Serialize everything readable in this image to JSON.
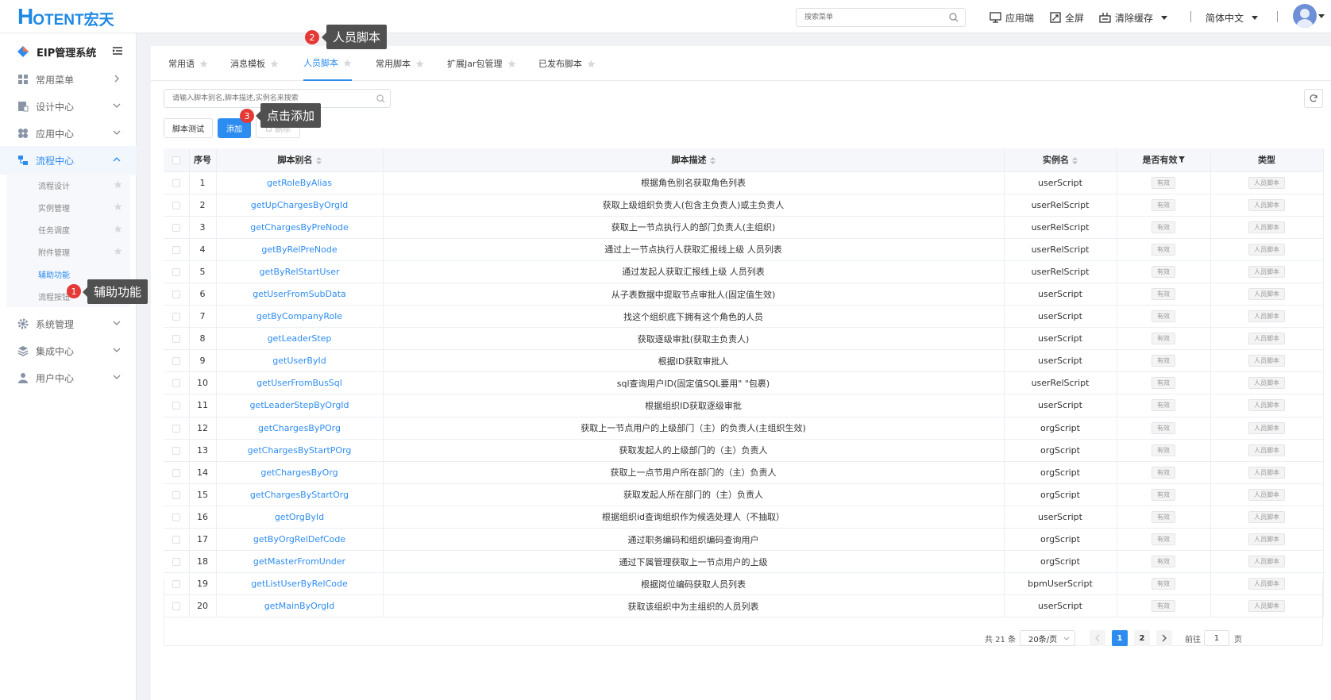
{
  "header": {
    "logo_h": "H",
    "logo_rest": "OTENT宏天",
    "search_placeholder": "搜索菜单",
    "app_end": "应用端",
    "fullscreen": "全屏",
    "clear_cache": "清除缓存",
    "language": "简体中文"
  },
  "sidebar": {
    "system_title": "EIP管理系统",
    "menus": [
      {
        "label": "常用菜单"
      },
      {
        "label": "设计中心"
      },
      {
        "label": "应用中心"
      },
      {
        "label": "流程中心"
      },
      {
        "label": "系统管理"
      },
      {
        "label": "集成中心"
      },
      {
        "label": "用户中心"
      }
    ],
    "sub_items": [
      "流程设计",
      "实例管理",
      "任务调度",
      "附件管理",
      "辅助功能",
      "流程按钮"
    ]
  },
  "tabs": [
    "常用语",
    "消息模板",
    "人员脚本",
    "常用脚本",
    "扩展Jar包管理",
    "已发布脚本"
  ],
  "toolbar": {
    "filter_placeholder": "请输入脚本别名,脚本描述,实例名来搜索",
    "test_label": "脚本测试",
    "add_label": "添加",
    "delete_label": "删除"
  },
  "table": {
    "headers": {
      "index": "序号",
      "alias": "脚本别名",
      "desc": "脚本描述",
      "instance": "实例名",
      "valid": "是否有效",
      "type": "类型"
    },
    "rows": [
      {
        "no": "1",
        "alias": "getRoleByAlias",
        "desc": "根据角色别名获取角色列表",
        "instance": "userScript",
        "valid": "有效",
        "type": "人员脚本"
      },
      {
        "no": "2",
        "alias": "getUpChargesByOrgId",
        "desc": "获取上级组织负责人(包含主负责人)或主负责人",
        "instance": "userRelScript",
        "valid": "有效",
        "type": "人员脚本"
      },
      {
        "no": "3",
        "alias": "getChargesByPreNode",
        "desc": "获取上一节点执行人的部门负责人(主组织)",
        "instance": "userRelScript",
        "valid": "有效",
        "type": "人员脚本"
      },
      {
        "no": "4",
        "alias": "getByRelPreNode",
        "desc": "通过上一节点执行人获取汇报线上级 人员列表",
        "instance": "userRelScript",
        "valid": "有效",
        "type": "人员脚本"
      },
      {
        "no": "5",
        "alias": "getByRelStartUser",
        "desc": "通过发起人获取汇报线上级 人员列表",
        "instance": "userRelScript",
        "valid": "有效",
        "type": "人员脚本"
      },
      {
        "no": "6",
        "alias": "getUserFromSubData",
        "desc": "从子表数据中提取节点审批人(固定值生效)",
        "instance": "userScript",
        "valid": "有效",
        "type": "人员脚本"
      },
      {
        "no": "7",
        "alias": "getByCompanyRole",
        "desc": "找这个组织底下拥有这个角色的人员",
        "instance": "userScript",
        "valid": "有效",
        "type": "人员脚本"
      },
      {
        "no": "8",
        "alias": "getLeaderStep",
        "desc": "获取逐级审批(获取主负责人)",
        "instance": "userScript",
        "valid": "有效",
        "type": "人员脚本"
      },
      {
        "no": "9",
        "alias": "getUserById",
        "desc": "根据ID获取审批人",
        "instance": "userScript",
        "valid": "有效",
        "type": "人员脚本"
      },
      {
        "no": "10",
        "alias": "getUserFromBusSql",
        "desc": "sql查询用户ID(固定值SQL要用\" \"包裹)",
        "instance": "userRelScript",
        "valid": "有效",
        "type": "人员脚本"
      },
      {
        "no": "11",
        "alias": "getLeaderStepByOrgId",
        "desc": "根据组织ID获取逐级审批",
        "instance": "userScript",
        "valid": "有效",
        "type": "人员脚本"
      },
      {
        "no": "12",
        "alias": "getChargesByPOrg",
        "desc": "获取上一节点用户的上级部门（主）的负责人(主组织生效)",
        "instance": "orgScript",
        "valid": "有效",
        "type": "人员脚本"
      },
      {
        "no": "13",
        "alias": "getChargesByStartPOrg",
        "desc": "获取发起人的上级部门的（主）负责人",
        "instance": "orgScript",
        "valid": "有效",
        "type": "人员脚本"
      },
      {
        "no": "14",
        "alias": "getChargesByOrg",
        "desc": "获取上一点节用户所在部门的（主）负责人",
        "instance": "orgScript",
        "valid": "有效",
        "type": "人员脚本"
      },
      {
        "no": "15",
        "alias": "getChargesByStartOrg",
        "desc": "获取发起人所在部门的（主）负责人",
        "instance": "orgScript",
        "valid": "有效",
        "type": "人员脚本"
      },
      {
        "no": "16",
        "alias": "getOrgById",
        "desc": "根据组织id查询组织作为候选处理人（不抽取）",
        "instance": "userScript",
        "valid": "有效",
        "type": "人员脚本"
      },
      {
        "no": "17",
        "alias": "getByOrgRelDefCode",
        "desc": "通过职务编码和组织编码查询用户",
        "instance": "orgScript",
        "valid": "有效",
        "type": "人员脚本"
      },
      {
        "no": "18",
        "alias": "getMasterFromUnder",
        "desc": "通过下属管理获取上一节点用户的上级",
        "instance": "orgScript",
        "valid": "有效",
        "type": "人员脚本"
      },
      {
        "no": "19",
        "alias": "getListUserByRelCode",
        "desc": "根据岗位编码获取人员列表",
        "instance": "bpmUserScript",
        "valid": "有效",
        "type": "人员脚本"
      },
      {
        "no": "20",
        "alias": "getMainByOrgId",
        "desc": "获取该组织中为主组织的人员列表",
        "instance": "userScript",
        "valid": "有效",
        "type": "人员脚本"
      }
    ]
  },
  "pagination": {
    "total": "共 21 条",
    "page_size": "20条/页",
    "pages": [
      "1",
      "2"
    ],
    "current": "1",
    "goto_label": "前往",
    "goto_value": "1",
    "page_suffix": "页"
  },
  "annotations": [
    {
      "num": "1",
      "text": "辅助功能"
    },
    {
      "num": "2",
      "text": "人员脚本"
    },
    {
      "num": "3",
      "text": "点击添加"
    }
  ],
  "colors": {
    "primary": "#2d8cf0",
    "logo": "#1e88e5",
    "badge": "#e53935",
    "tooltip": "#505050"
  }
}
